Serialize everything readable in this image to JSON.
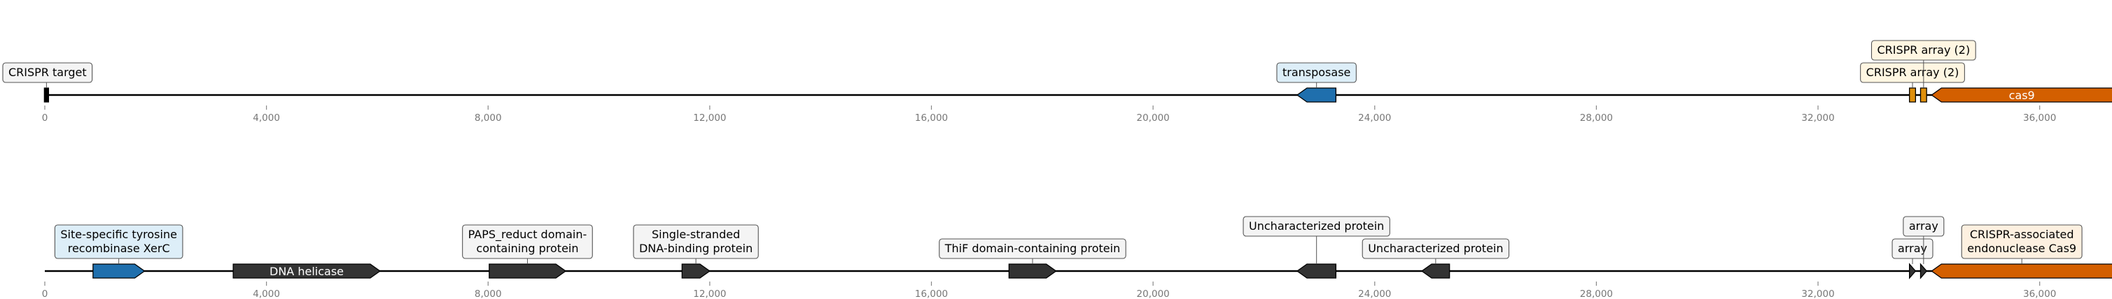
{
  "tracks": [
    {
      "id": "track-1",
      "range": [
        0,
        38000
      ],
      "ticks": [
        0,
        4000,
        8000,
        12000,
        16000,
        20000,
        24000,
        28000,
        32000,
        36000
      ],
      "tick_labels": [
        "0",
        "4,000",
        "8,000",
        "12,000",
        "16,000",
        "20,000",
        "24,000",
        "28,000",
        "32,000",
        "36,000"
      ],
      "features": [
        {
          "name": "crispr-target",
          "start": 0,
          "end": 60,
          "strand": 0,
          "color": "#000000",
          "label": [
            "CRISPR target"
          ],
          "label_mode": "box",
          "box_fill": "#f4f4f4",
          "row": 0
        },
        {
          "name": "transposase",
          "start": 22600,
          "end": 23300,
          "strand": -1,
          "color": "#1f6fad",
          "label": [
            "transposase"
          ],
          "label_mode": "box",
          "box_fill": "#ddeef8",
          "row": 0
        },
        {
          "name": "crispr-array-1",
          "start": 33650,
          "end": 33760,
          "strand": 0,
          "color": "#e0900c",
          "label": [
            "CRISPR array (2)"
          ],
          "label_mode": "box",
          "box_fill": "#fff6e2",
          "row": 0
        },
        {
          "name": "crispr-array-2",
          "start": 33850,
          "end": 33960,
          "strand": 0,
          "color": "#e0900c",
          "label": [
            "CRISPR array (2)"
          ],
          "label_mode": "box",
          "box_fill": "#fff6e2",
          "row": 1
        },
        {
          "name": "cas9",
          "start": 34050,
          "end": 38000,
          "strand": -1,
          "color": "#d35f00",
          "label": [
            "cas9"
          ],
          "label_mode": "inline",
          "row": 0
        }
      ]
    },
    {
      "id": "track-2",
      "range": [
        0,
        38000
      ],
      "ticks": [
        0,
        4000,
        8000,
        12000,
        16000,
        20000,
        24000,
        28000,
        32000,
        36000
      ],
      "tick_labels": [
        "0",
        "4,000",
        "8,000",
        "12,000",
        "16,000",
        "20,000",
        "24,000",
        "28,000",
        "32,000",
        "36,000"
      ],
      "features": [
        {
          "name": "site-specific-tyrosine-recombinase",
          "start": 870,
          "end": 1800,
          "strand": 1,
          "color": "#1f6fad",
          "label": [
            "Site-specific tyrosine",
            "recombinase XerC"
          ],
          "label_mode": "box",
          "box_fill": "#ddeef8",
          "row": 0
        },
        {
          "name": "dna-helicase",
          "start": 3400,
          "end": 6050,
          "strand": 1,
          "color": "#333333",
          "label": [
            "DNA helicase"
          ],
          "label_mode": "inline",
          "row": 0
        },
        {
          "name": "paps-reduct-domain-protein",
          "start": 8020,
          "end": 9400,
          "strand": 1,
          "color": "#333333",
          "label": [
            "PAPS_reduct domain-",
            "containing protein"
          ],
          "label_mode": "box",
          "box_fill": "#f4f4f4",
          "row": 0
        },
        {
          "name": "single-stranded-dna-binding-protein",
          "start": 11500,
          "end": 12000,
          "strand": 1,
          "color": "#333333",
          "label": [
            "Single-stranded",
            "DNA-binding protein"
          ],
          "label_mode": "box",
          "box_fill": "#f4f4f4",
          "row": 0
        },
        {
          "name": "thif-domain-protein",
          "start": 17400,
          "end": 18250,
          "strand": 1,
          "color": "#333333",
          "label": [
            "ThiF domain-containing protein"
          ],
          "label_mode": "box",
          "box_fill": "#f4f4f4",
          "row": 0
        },
        {
          "name": "uncharacterized-protein-1",
          "start": 22600,
          "end": 23300,
          "strand": -1,
          "color": "#333333",
          "label": [
            "Uncharacterized protein"
          ],
          "label_mode": "box",
          "box_fill": "#f4f4f4",
          "row": 1
        },
        {
          "name": "uncharacterized-protein-2",
          "start": 24850,
          "end": 25350,
          "strand": -1,
          "color": "#333333",
          "label": [
            "Uncharacterized protein"
          ],
          "label_mode": "box",
          "box_fill": "#f4f4f4",
          "row": 0
        },
        {
          "name": "array-1",
          "start": 33650,
          "end": 33760,
          "strand": 1,
          "color": "#333333",
          "label": [
            "array"
          ],
          "label_mode": "box",
          "box_fill": "#f4f4f4",
          "row": 0
        },
        {
          "name": "array-2",
          "start": 33850,
          "end": 33960,
          "strand": 1,
          "color": "#333333",
          "label": [
            "array"
          ],
          "label_mode": "box",
          "box_fill": "#f4f4f4",
          "row": 1
        },
        {
          "name": "crispr-associated-endonuclease-cas9",
          "start": 34050,
          "end": 38000,
          "strand": -1,
          "color": "#d35f00",
          "label": [
            "CRISPR-associated",
            "endonuclease Cas9"
          ],
          "label_mode": "box",
          "box_fill": "#fdf0e0",
          "row": 0
        }
      ]
    }
  ]
}
